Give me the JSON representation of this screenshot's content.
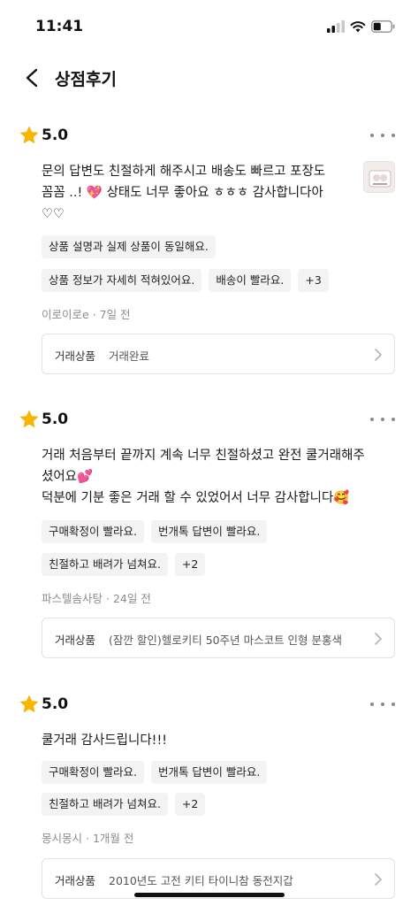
{
  "status_bar": {
    "time": "11:41"
  },
  "header": {
    "title": "상점후기"
  },
  "reviews": [
    {
      "rating": "5.0",
      "text": "문의 답변도 친절하게 해주시고 배송도 빠르고 포장도\n꼼꼼 ..! 💖 상태도 너무 좋아요 ㅎㅎㅎ 감사합니다아\n♡♡",
      "tags_row1": [
        "상품 설명과 실제 상품이 동일해요."
      ],
      "tags_row2": [
        "상품 정보가 자세히 적혀있어요.",
        "배송이 빨라요.",
        "+3"
      ],
      "reviewer": "이로이로e",
      "time": "· 7일 전",
      "deal_label": "거래상품",
      "deal_product": "거래완료"
    },
    {
      "rating": "5.0",
      "text": "거래 처음부터 끝까지 계속 너무 친절하셨고 완전 쿨거래해주\n셨어요💕\n덕분에 기분 좋은 거래 할 수 있었어서 너무 감사합니다🥰",
      "tags_row1": [
        "구매확정이 빨라요.",
        "번개톡 답변이 빨라요."
      ],
      "tags_row2": [
        "친절하고 배려가 넘쳐요.",
        "+2"
      ],
      "reviewer": "파스텔솜사탕",
      "time": "· 24일 전",
      "deal_label": "거래상품",
      "deal_product": "(잠깐 할인)헬로키티 50주년 마스코트 인형 분홍색"
    },
    {
      "rating": "5.0",
      "text": "쿨거래 감사드립니다!!!",
      "tags_row1": [
        "구매확정이 빨라요.",
        "번개톡 답변이 빨라요."
      ],
      "tags_row2": [
        "친절하고 배려가 넘쳐요.",
        "+2"
      ],
      "reviewer": "몽시몽시",
      "time": "· 1개월 전",
      "deal_label": "거래상품",
      "deal_product": "2010년도 고전 키티 타이니참 동전지갑"
    }
  ],
  "icons": {
    "star": "star-icon",
    "back": "chevron-left-icon",
    "more": "more-horizontal-icon",
    "chevron": "chevron-right-icon"
  },
  "colors": {
    "star": "#F7B500",
    "tag_bg": "#F3F3F3",
    "meta_text": "#8C8C8C",
    "border": "#E2E2E2"
  }
}
